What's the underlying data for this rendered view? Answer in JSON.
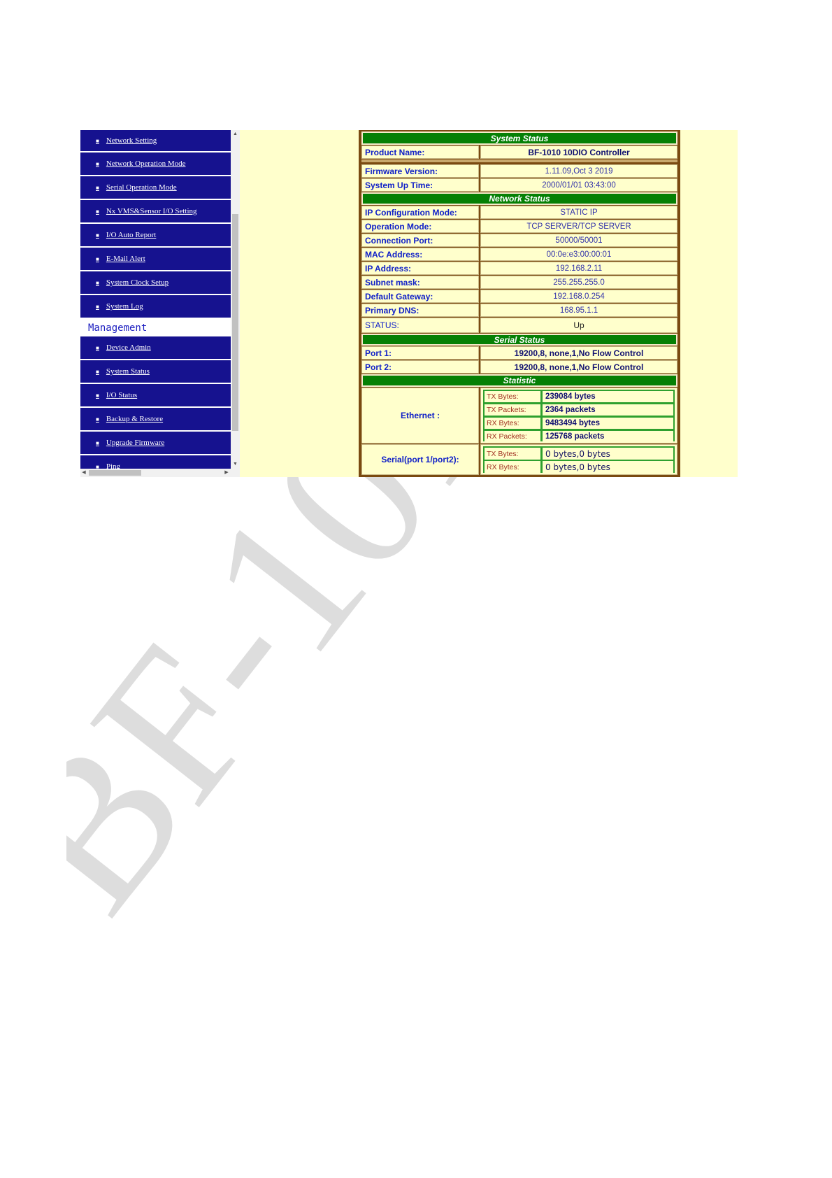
{
  "watermark": {
    "text": "BF-101"
  },
  "nav": {
    "items_top": [
      "Network Setting",
      "Network Operation Mode",
      "Serial Operation Mode",
      "Nx VMS&Sensor I/O Setting",
      "I/O Auto Report",
      "E-Mail Alert",
      "System Clock Setup",
      "System Log"
    ],
    "section_heading": "Management",
    "items_management": [
      "Device Admin",
      "System Status",
      "I/O Status",
      "Backup & Restore",
      "Upgrade Firmware",
      "Ping"
    ]
  },
  "system_status": {
    "title": "System Status",
    "product_name": {
      "label": "Product Name:",
      "value": "BF-1010 10DIO Controller"
    },
    "firmware": {
      "label": "Firmware Version:",
      "value": "1.11.09,Oct 3 2019"
    },
    "uptime": {
      "label": "System Up Time:",
      "value": "2000/01/01 03:43:00"
    }
  },
  "network_status": {
    "title": "Network Status",
    "rows": [
      {
        "label": "IP Configuration Mode:",
        "value": "STATIC IP"
      },
      {
        "label": "Operation Mode:",
        "value": "TCP SERVER/TCP SERVER"
      },
      {
        "label": "Connection Port:",
        "value": "50000/50001"
      },
      {
        "label": "MAC Address:",
        "value": "00:0e:e3:00:00:01"
      },
      {
        "label": "IP Address:",
        "value": "192.168.2.11"
      },
      {
        "label": "Subnet mask:",
        "value": "255.255.255.0"
      },
      {
        "label": "Default Gateway:",
        "value": "192.168.0.254"
      },
      {
        "label": "Primary DNS:",
        "value": "168.95.1.1"
      },
      {
        "label": "STATUS:",
        "value": "Up"
      }
    ]
  },
  "serial_status": {
    "title": "Serial Status",
    "rows": [
      {
        "label": "Port 1:",
        "value": "19200,8, none,1,No Flow Control"
      },
      {
        "label": "Port 2:",
        "value": "19200,8, none,1,No Flow Control"
      }
    ]
  },
  "statistic": {
    "title": "Statistic",
    "ethernet": {
      "label": "Ethernet :",
      "rows": [
        {
          "key": "TX Bytes:",
          "value": "239084 bytes"
        },
        {
          "key": "TX Packets:",
          "value": "2364 packets"
        },
        {
          "key": "RX Bytes:",
          "value": "9483494 bytes"
        },
        {
          "key": "RX Packets:",
          "value": "125768 packets"
        }
      ]
    },
    "serial": {
      "label": "Serial(port 1/port2):",
      "rows": [
        {
          "key": "TX Bytes:",
          "value": "0 bytes,0 bytes"
        },
        {
          "key": "RX Bytes:",
          "value": "0 bytes,0 bytes"
        }
      ]
    }
  }
}
